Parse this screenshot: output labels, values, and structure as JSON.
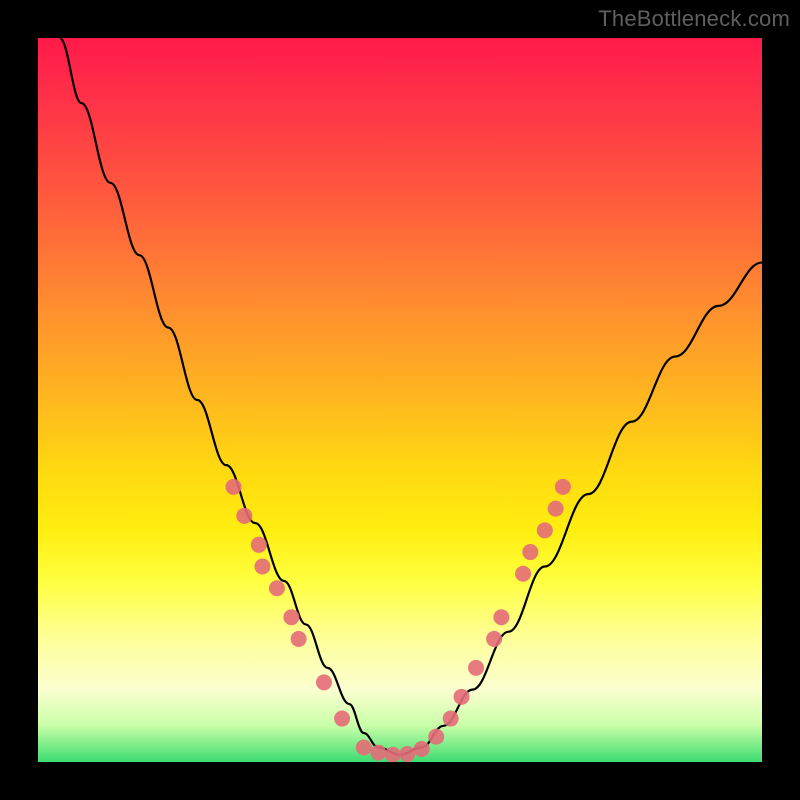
{
  "watermark": "TheBottleneck.com",
  "chart_data": {
    "type": "line",
    "title": "",
    "xlabel": "",
    "ylabel": "",
    "xlim": [
      0,
      100
    ],
    "ylim": [
      0,
      100
    ],
    "series": [
      {
        "name": "bottleneck-curve",
        "x": [
          3,
          6,
          10,
          14,
          18,
          22,
          26,
          30,
          34,
          37,
          40,
          43,
          45,
          47,
          50,
          53,
          56,
          60,
          65,
          70,
          76,
          82,
          88,
          94,
          100
        ],
        "y": [
          100,
          91,
          80,
          70,
          60,
          50,
          41,
          33,
          25,
          19,
          13,
          8,
          4,
          2,
          1,
          2,
          5,
          10,
          18,
          27,
          37,
          47,
          56,
          63,
          69
        ]
      }
    ],
    "markers": {
      "name": "highlight-dots",
      "color": "#e46b78",
      "points": [
        {
          "x": 27,
          "y": 38
        },
        {
          "x": 28.5,
          "y": 34
        },
        {
          "x": 30.5,
          "y": 30
        },
        {
          "x": 31,
          "y": 27
        },
        {
          "x": 33,
          "y": 24
        },
        {
          "x": 35,
          "y": 20
        },
        {
          "x": 36,
          "y": 17
        },
        {
          "x": 39.5,
          "y": 11
        },
        {
          "x": 42,
          "y": 6
        },
        {
          "x": 45,
          "y": 2
        },
        {
          "x": 47,
          "y": 1.3
        },
        {
          "x": 49,
          "y": 1
        },
        {
          "x": 51,
          "y": 1.1
        },
        {
          "x": 53,
          "y": 1.8
        },
        {
          "x": 55,
          "y": 3.5
        },
        {
          "x": 57,
          "y": 6
        },
        {
          "x": 58.5,
          "y": 9
        },
        {
          "x": 60.5,
          "y": 13
        },
        {
          "x": 63,
          "y": 17
        },
        {
          "x": 64,
          "y": 20
        },
        {
          "x": 67,
          "y": 26
        },
        {
          "x": 68,
          "y": 29
        },
        {
          "x": 70,
          "y": 32
        },
        {
          "x": 71.5,
          "y": 35
        },
        {
          "x": 72.5,
          "y": 38
        }
      ]
    }
  }
}
